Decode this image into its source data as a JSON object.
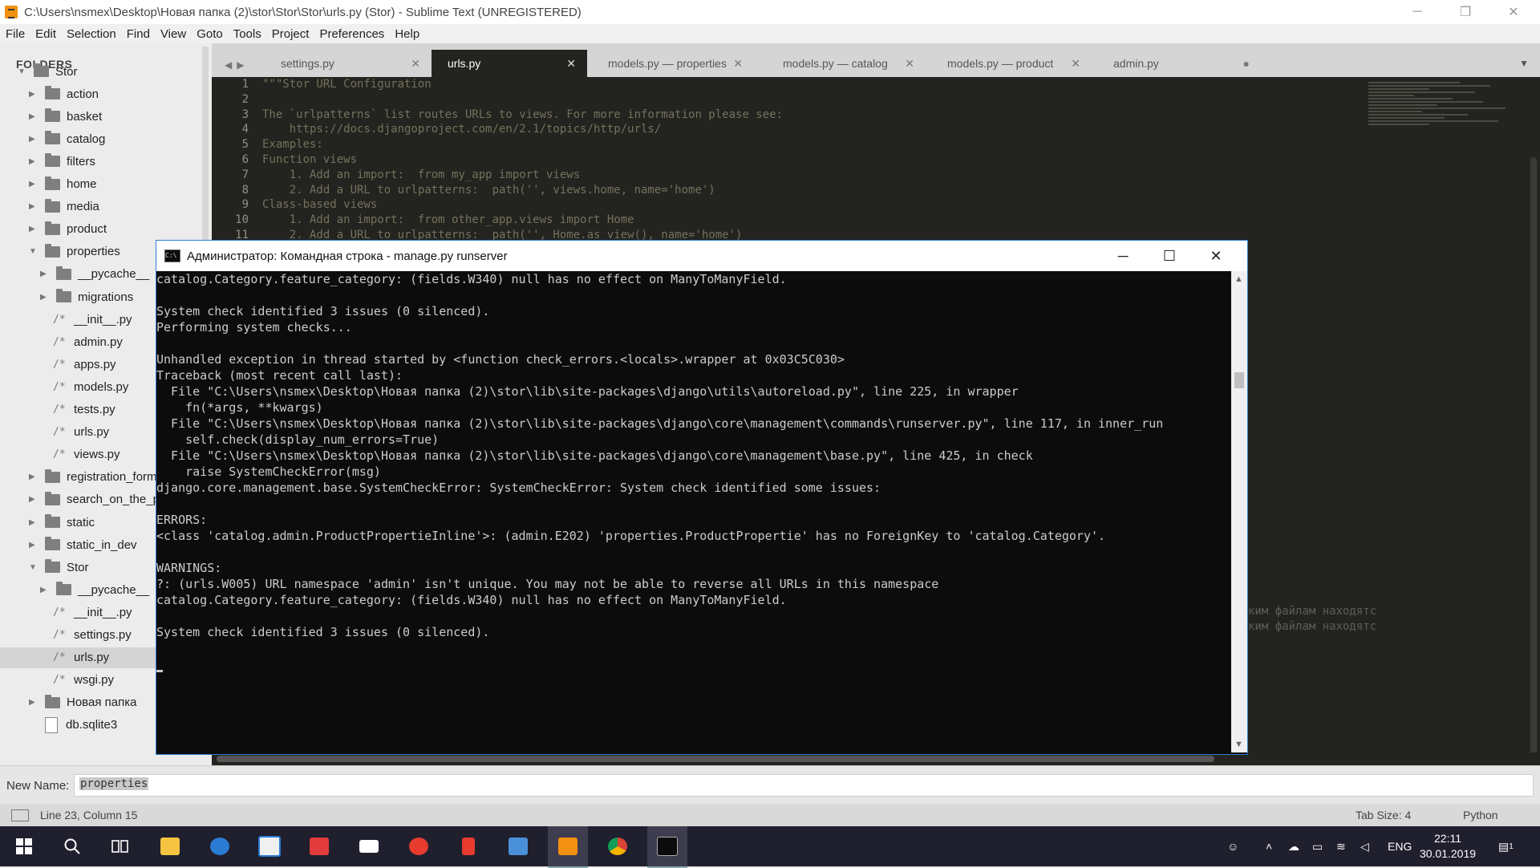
{
  "window": {
    "title": "C:\\Users\\nsmex\\Desktop\\Новая папка (2)\\stor\\Stor\\Stor\\urls.py (Stor) - Sublime Text (UNREGISTERED)",
    "min": "─",
    "max": "❐",
    "close": "✕"
  },
  "menu": [
    "File",
    "Edit",
    "Selection",
    "Find",
    "View",
    "Goto",
    "Tools",
    "Project",
    "Preferences",
    "Help"
  ],
  "sidebar": {
    "header": "FOLDERS",
    "items": [
      {
        "label": "Stor",
        "kind": "folder",
        "open": true,
        "depth": 0
      },
      {
        "label": "action",
        "kind": "folder",
        "open": false,
        "depth": 1
      },
      {
        "label": "basket",
        "kind": "folder",
        "open": false,
        "depth": 1
      },
      {
        "label": "catalog",
        "kind": "folder",
        "open": false,
        "depth": 1
      },
      {
        "label": "filters",
        "kind": "folder",
        "open": false,
        "depth": 1
      },
      {
        "label": "home",
        "kind": "folder",
        "open": false,
        "depth": 1
      },
      {
        "label": "media",
        "kind": "folder",
        "open": false,
        "depth": 1
      },
      {
        "label": "product",
        "kind": "folder",
        "open": false,
        "depth": 1
      },
      {
        "label": "properties",
        "kind": "folder",
        "open": true,
        "depth": 1
      },
      {
        "label": "__pycache__",
        "kind": "folder",
        "open": false,
        "depth": 2
      },
      {
        "label": "migrations",
        "kind": "folder",
        "open": false,
        "depth": 2
      },
      {
        "label": "__init__.py",
        "kind": "file",
        "depth": 2
      },
      {
        "label": "admin.py",
        "kind": "file",
        "depth": 2
      },
      {
        "label": "apps.py",
        "kind": "file",
        "depth": 2
      },
      {
        "label": "models.py",
        "kind": "file",
        "depth": 2
      },
      {
        "label": "tests.py",
        "kind": "file",
        "depth": 2
      },
      {
        "label": "urls.py",
        "kind": "file",
        "depth": 2
      },
      {
        "label": "views.py",
        "kind": "file",
        "depth": 2
      },
      {
        "label": "registration_form",
        "kind": "folder",
        "open": false,
        "depth": 1
      },
      {
        "label": "search_on_the_pr",
        "kind": "folder",
        "open": false,
        "depth": 1
      },
      {
        "label": "static",
        "kind": "folder",
        "open": false,
        "depth": 1
      },
      {
        "label": "static_in_dev",
        "kind": "folder",
        "open": false,
        "depth": 1
      },
      {
        "label": "Stor",
        "kind": "folder",
        "open": true,
        "depth": 1
      },
      {
        "label": "__pycache__",
        "kind": "folder",
        "open": false,
        "depth": 2
      },
      {
        "label": "__init__.py",
        "kind": "file",
        "depth": 2
      },
      {
        "label": "settings.py",
        "kind": "file",
        "depth": 2
      },
      {
        "label": "urls.py",
        "kind": "file",
        "depth": 2,
        "selected": true
      },
      {
        "label": "wsgi.py",
        "kind": "file",
        "depth": 2
      },
      {
        "label": "Новая папка",
        "kind": "folder",
        "open": false,
        "depth": 1
      },
      {
        "label": "db.sqlite3",
        "kind": "db",
        "depth": 1
      }
    ]
  },
  "tabs": [
    {
      "label": "settings.py",
      "close": "✕",
      "active": false
    },
    {
      "label": "urls.py",
      "close": "✕",
      "active": true
    },
    {
      "label": "models.py — properties",
      "close": "✕",
      "active": false
    },
    {
      "label": "models.py — catalog",
      "close": "✕",
      "active": false
    },
    {
      "label": "models.py — product",
      "close": "✕",
      "active": false
    },
    {
      "label": "admin.py",
      "close": "●",
      "active": false
    }
  ],
  "editor": {
    "lines": [
      "\"\"\"Stor URL Configuration",
      "",
      "The `urlpatterns` list routes URLs to views. For more information please see:",
      "    https://docs.djangoproject.com/en/2.1/topics/http/urls/",
      "Examples:",
      "Function views",
      "    1. Add an import:  from my_app import views",
      "    2. Add a URL to urlpatterns:  path('', views.home, name='home')",
      "Class-based views",
      "    1. Add an import:  from other_app.views import Home",
      "    2. Add a URL to urlpatterns:  path('', Home.as_view(), name='home')"
    ],
    "faded": [
      "ким файлам находятс",
      "ким файлам находятс"
    ]
  },
  "cmd": {
    "title": "Администратор: Командная строка - manage.py  runserver",
    "icon": "C:\\",
    "min": "─",
    "max": "☐",
    "close": "✕",
    "scroll_up": "▲",
    "scroll_down": "▼",
    "lines": [
      "catalog.Category.feature_category: (fields.W340) null has no effect on ManyToManyField.",
      "",
      "System check identified 3 issues (0 silenced).",
      "Performing system checks...",
      "",
      "Unhandled exception in thread started by <function check_errors.<locals>.wrapper at 0x03C5C030>",
      "Traceback (most recent call last):",
      "  File \"C:\\Users\\nsmex\\Desktop\\Новая папка (2)\\stor\\lib\\site-packages\\django\\utils\\autoreload.py\", line 225, in wrapper",
      "    fn(*args, **kwargs)",
      "  File \"C:\\Users\\nsmex\\Desktop\\Новая папка (2)\\stor\\lib\\site-packages\\django\\core\\management\\commands\\runserver.py\", line 117, in inner_run",
      "    self.check(display_num_errors=True)",
      "  File \"C:\\Users\\nsmex\\Desktop\\Новая папка (2)\\stor\\lib\\site-packages\\django\\core\\management\\base.py\", line 425, in check",
      "    raise SystemCheckError(msg)",
      "django.core.management.base.SystemCheckError: SystemCheckError: System check identified some issues:",
      "",
      "ERRORS:",
      "<class 'catalog.admin.ProductPropertieInline'>: (admin.E202) 'properties.ProductPropertie' has no ForeignKey to 'catalog.Category'.",
      "",
      "WARNINGS:",
      "?: (urls.W005) URL namespace 'admin' isn't unique. You may not be able to reverse all URLs in this namespace",
      "catalog.Category.feature_category: (fields.W340) null has no effect on ManyToManyField.",
      "",
      "System check identified 3 issues (0 silenced)."
    ]
  },
  "input_panel": {
    "label": "New Name:",
    "value": "properties"
  },
  "statusbar": {
    "position": "Line 23, Column 15",
    "tab_size": "Tab Size: 4",
    "syntax": "Python"
  },
  "taskbar": {
    "apps": [
      "start",
      "search",
      "task-view",
      "file-explorer",
      "edge",
      "store",
      "gift",
      "mail",
      "yandex-browser",
      "yandex",
      "remote",
      "sublime-text",
      "chrome",
      "command-prompt"
    ],
    "tray": {
      "lang": "ENG",
      "time": "22:11",
      "date": "30.01.2019",
      "notifications": "1"
    }
  },
  "colors": {
    "editor_bg": "#23241f",
    "comment": "#75715e",
    "cmd_bg": "#0c0c0c",
    "cmd_fg": "#cccccc",
    "cmd_border": "#2d7dd2",
    "taskbar": "#1f1f2e"
  }
}
